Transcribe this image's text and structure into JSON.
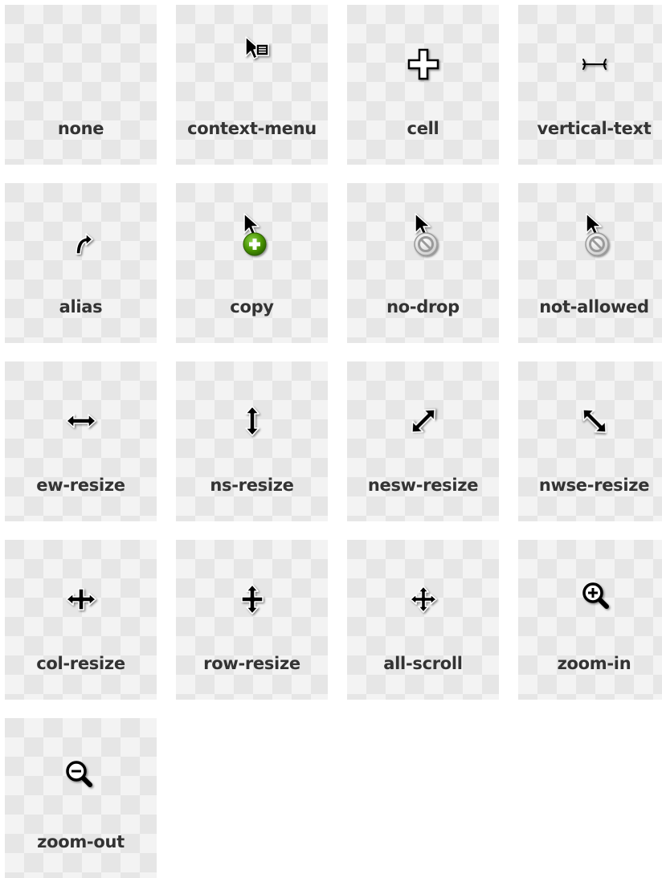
{
  "cursors": [
    {
      "label": "none",
      "icon": "none"
    },
    {
      "label": "context-menu",
      "icon": "context-menu-icon"
    },
    {
      "label": "cell",
      "icon": "cell-icon"
    },
    {
      "label": "vertical-text",
      "icon": "vertical-text-icon"
    },
    {
      "label": "alias",
      "icon": "alias-icon"
    },
    {
      "label": "copy",
      "icon": "copy-icon"
    },
    {
      "label": "no-drop",
      "icon": "no-drop-icon"
    },
    {
      "label": "not-allowed",
      "icon": "not-allowed-icon"
    },
    {
      "label": "ew-resize",
      "icon": "ew-resize-icon"
    },
    {
      "label": "ns-resize",
      "icon": "ns-resize-icon"
    },
    {
      "label": "nesw-resize",
      "icon": "nesw-resize-icon"
    },
    {
      "label": "nwse-resize",
      "icon": "nwse-resize-icon"
    },
    {
      "label": "col-resize",
      "icon": "col-resize-icon"
    },
    {
      "label": "row-resize",
      "icon": "row-resize-icon"
    },
    {
      "label": "all-scroll",
      "icon": "all-scroll-icon"
    },
    {
      "label": "zoom-in",
      "icon": "zoom-in-icon"
    },
    {
      "label": "zoom-out",
      "icon": "zoom-out-icon"
    }
  ],
  "colors": {
    "label_text": "#333333",
    "copy_badge": "#4e9a06"
  }
}
